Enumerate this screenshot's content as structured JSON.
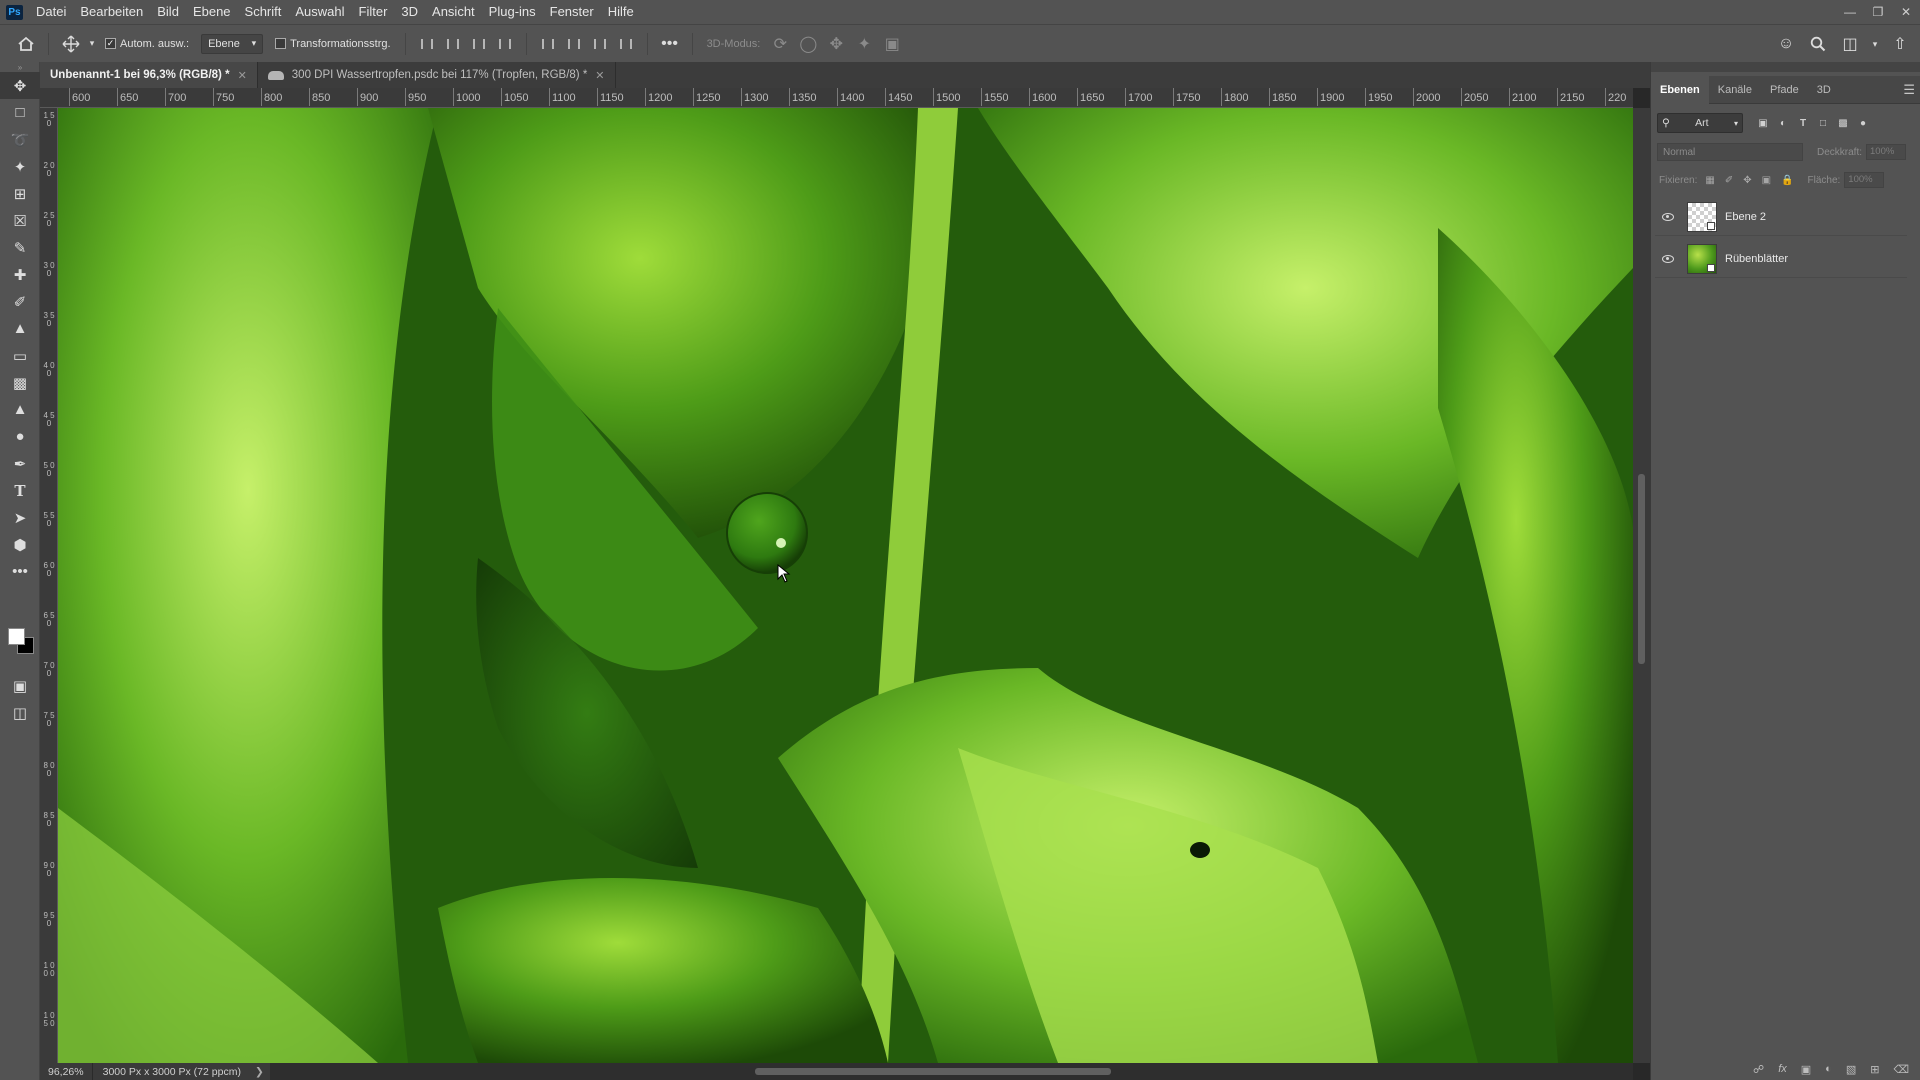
{
  "menubar": {
    "logo": "Ps",
    "items": [
      "Datei",
      "Bearbeiten",
      "Bild",
      "Ebene",
      "Schrift",
      "Auswahl",
      "Filter",
      "3D",
      "Ansicht",
      "Plug-ins",
      "Fenster",
      "Hilfe"
    ]
  },
  "options": {
    "auto_select_label": "Autom. ausw.:",
    "auto_select_checked": true,
    "target_select": "Ebene",
    "transform_label": "Transformationsstrg.",
    "transform_checked": false,
    "mode3d_label": "3D-Modus:"
  },
  "tabs": [
    {
      "label": "Unbenannt-1 bei 96,3% (RGB/8) *",
      "active": true
    },
    {
      "label": "300 DPI Wassertropfen.psdc bei 117% (Tropfen, RGB/8) *",
      "active": false
    }
  ],
  "ruler_h": [
    "600",
    "650",
    "700",
    "750",
    "800",
    "850",
    "900",
    "950",
    "1000",
    "1050",
    "1100",
    "1150",
    "1200",
    "1250",
    "1300",
    "1350",
    "1400",
    "1450",
    "1500",
    "1550",
    "1600",
    "1650",
    "1700",
    "1750",
    "1800",
    "1850",
    "1900",
    "1950",
    "2000",
    "2050",
    "2100",
    "2150",
    "220"
  ],
  "ruler_v": [
    "1\n5\n0",
    "2\n0\n0",
    "2\n5\n0",
    "3\n0\n0",
    "3\n5\n0",
    "4\n0\n0",
    "4\n5\n0",
    "5\n0\n0",
    "5\n5\n0",
    "6\n0\n0",
    "6\n5\n0",
    "7\n0\n0",
    "7\n5\n0",
    "8\n0\n0",
    "8\n5\n0",
    "9\n0\n0",
    "9\n5\n0",
    "1\n0\n0\n0",
    "1\n0\n5\n0"
  ],
  "status": {
    "zoom": "96,26%",
    "doc_info": "3000 Px x 3000 Px (72 ppcm)"
  },
  "panel": {
    "tabs": [
      "Ebenen",
      "Kanäle",
      "Pfade",
      "3D"
    ],
    "active_tab": "Ebenen",
    "filter_label": "Art",
    "blend_mode": "Normal",
    "opacity_label": "Deckkraft:",
    "opacity_value": "100%",
    "lock_label": "Fixieren:",
    "fill_label": "Fläche:",
    "fill_value": "100%",
    "layers": [
      {
        "name": "Ebene 2",
        "visible": true,
        "thumb": "transparent"
      },
      {
        "name": "Rübenblätter",
        "visible": true,
        "thumb": "leaf"
      }
    ]
  },
  "colors": {
    "foreground": "#ffffff",
    "background": "#000000",
    "ui_dark": "#535353",
    "accent": "#31a8ff"
  }
}
